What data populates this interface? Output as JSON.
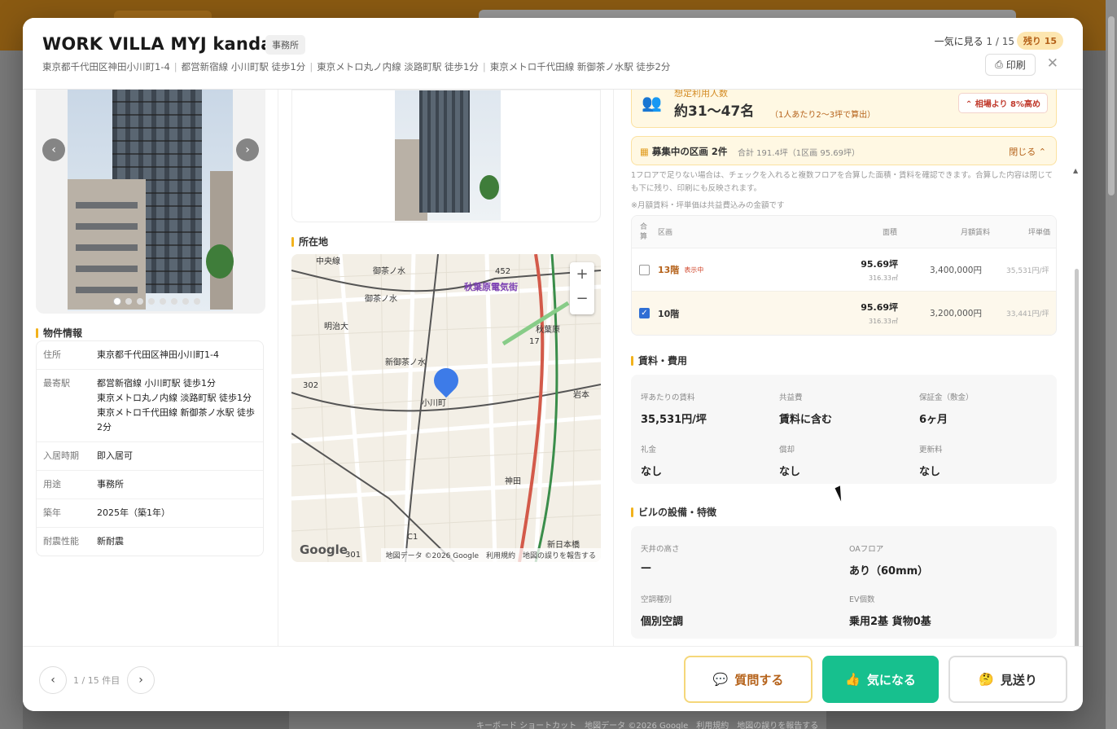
{
  "header": {
    "title": "WORK VILLA MYJ kanda",
    "type_tag": "事務所",
    "access": [
      "東京都千代田区神田小川町1-4",
      "都営新宿線 小川町駅 徒歩1分",
      "東京メトロ丸ノ内線 淡路町駅 徒歩1分",
      "東京メトロ千代田線 新御茶ノ水駅 徒歩2分"
    ],
    "ikki_label": "一気に見る",
    "ikki_count": "1 / 15",
    "remaining": "残り 15",
    "print_label": "印刷",
    "close": "✕"
  },
  "gallery": {
    "prev": "‹",
    "next": "›",
    "dots": 8,
    "active": 0
  },
  "property_info": {
    "heading": "物件情報",
    "rows": [
      {
        "k": "住所",
        "v": "東京都千代田区神田小川町1-4"
      },
      {
        "k": "最寄駅",
        "v": "都営新宿線 小川町駅 徒歩1分",
        "v2": "東京メトロ丸ノ内線 淡路町駅 徒歩1分",
        "v3": "東京メトロ千代田線 新御茶ノ水駅 徒歩2分"
      },
      {
        "k": "入居時期",
        "v": "即入居可"
      },
      {
        "k": "用途",
        "v": "事務所"
      },
      {
        "k": "築年",
        "v": "2025年（築1年）"
      },
      {
        "k": "耐震性能",
        "v": "新耐震"
      }
    ]
  },
  "location": {
    "heading": "所在地",
    "zoom_in": "+",
    "zoom_out": "−",
    "google": "Google",
    "attribution": "地図データ ©2026 Google　利用規約　地図の誤りを報告する",
    "labels": {
      "chuo": "中央線",
      "ochanomizu1": "御茶ノ水",
      "ochanomizu2": "御茶ノ水",
      "akiba_denki": "秋葉原電気街",
      "meijidai": "明治大",
      "shin_ocha": "新御茶ノ水",
      "akihabara": "秋葉原",
      "ogawa": "小川町",
      "iwamoto": "岩本",
      "kanda": "神田",
      "shinnihonbashi": "新日本橋",
      "route302": "302",
      "route452": "452",
      "route17": "17",
      "route301": "301",
      "routeC1": "C1"
    }
  },
  "occupancy": {
    "cut_label": "想定利用人数",
    "value": "約31〜47名",
    "note": "（1人あたり2〜3坪で算出）",
    "badge": "相場より 8%高め"
  },
  "recruiting": {
    "title": "募集中の区画 2件",
    "summary": "合計 191.4坪（1区画 95.69坪）",
    "close_label": "閉じる",
    "note": "1フロアで足りない場合は、チェックを入れると複数フロアを合算した面積・賃料を確認できます。合算した内容は閉じても下に残り、印刷にも反映されます。",
    "note2": "※月額賃料・坪単価は共益費込みの金額です",
    "headers": {
      "check": "合算",
      "floor": "区画",
      "area": "面積",
      "rent": "月額賃料",
      "tsubo": "坪単価"
    },
    "rows": [
      {
        "floor": "13階",
        "tag": "表示中",
        "area": "95.69坪",
        "area_m2": "316.33㎡",
        "rent": "3,400,000円",
        "tsubo": "35,531円/坪",
        "checked": false
      },
      {
        "floor": "10階",
        "tag": "",
        "area": "95.69坪",
        "area_m2": "316.33㎡",
        "rent": "3,200,000円",
        "tsubo": "33,441円/坪",
        "checked": true
      }
    ]
  },
  "fees": {
    "heading": "賃料・費用",
    "items": [
      {
        "k": "坪あたりの賃料",
        "v": "35,531円/坪"
      },
      {
        "k": "共益費",
        "v": "賃料に含む"
      },
      {
        "k": "保証金（敷金）",
        "v": "6ヶ月"
      },
      {
        "k": "礼金",
        "v": "なし"
      },
      {
        "k": "償却",
        "v": "なし"
      },
      {
        "k": "更新料",
        "v": "なし"
      }
    ]
  },
  "equipment": {
    "heading": "ビルの設備・特徴",
    "items": [
      {
        "k": "天井の高さ",
        "v": "—"
      },
      {
        "k": "OAフロア",
        "v": "あり（60mm）"
      },
      {
        "k": "空調種別",
        "v": "個別空調"
      },
      {
        "k": "EV個数",
        "v": "乗用2基 貨物0基"
      }
    ]
  },
  "footer": {
    "prev": "‹",
    "next": "›",
    "page": "1 / 15 件目",
    "ask": "質問する",
    "like": "気になる",
    "skip": "見送り"
  },
  "background": {
    "map_attr": "キーボード ショートカット　地図データ ©2026 Google　利用規約　地図の誤りを報告する"
  },
  "colors": {
    "accent": "#17c08e",
    "warn": "#f2b21c",
    "brand": "#b5621a"
  }
}
